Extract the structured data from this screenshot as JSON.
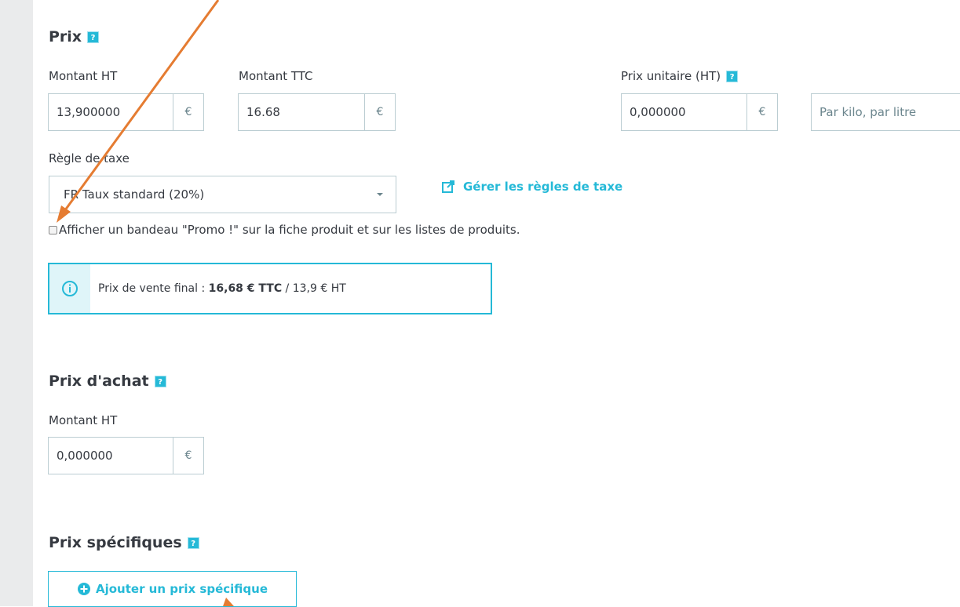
{
  "prix": {
    "title": "Prix",
    "help_icon": "question-icon",
    "montant_ht_label": "Montant HT",
    "montant_ht_value": "13,900000",
    "montant_ttc_label": "Montant TTC",
    "montant_ttc_value": "16.68",
    "currency": "€",
    "prix_unitaire_label": "Prix unitaire (HT)",
    "prix_unitaire_value": "0,000000",
    "unit_placeholder": "Par kilo, par litre",
    "regle_taxe_label": "Règle de taxe",
    "regle_taxe_value": "FR Taux standard (20%)",
    "gerer_link": "Gérer les règles de taxe",
    "promo_checkbox_label": "Afficher un bandeau \"Promo !\" sur la fiche produit et sur les listes de produits.",
    "promo_checked": false,
    "final_prefix": "Prix de vente final : ",
    "final_ttc": "16,68 € TTC",
    "final_ht": " / 13,9 € HT"
  },
  "prix_achat": {
    "title": "Prix d'achat",
    "montant_ht_label": "Montant HT",
    "montant_ht_value": "0,000000",
    "currency": "€"
  },
  "prix_specifiques": {
    "title": "Prix spécifiques",
    "add_button": "Ajouter un prix spécifique"
  },
  "colors": {
    "accent": "#25b9d7",
    "annotation_arrow": "#e57c32"
  }
}
